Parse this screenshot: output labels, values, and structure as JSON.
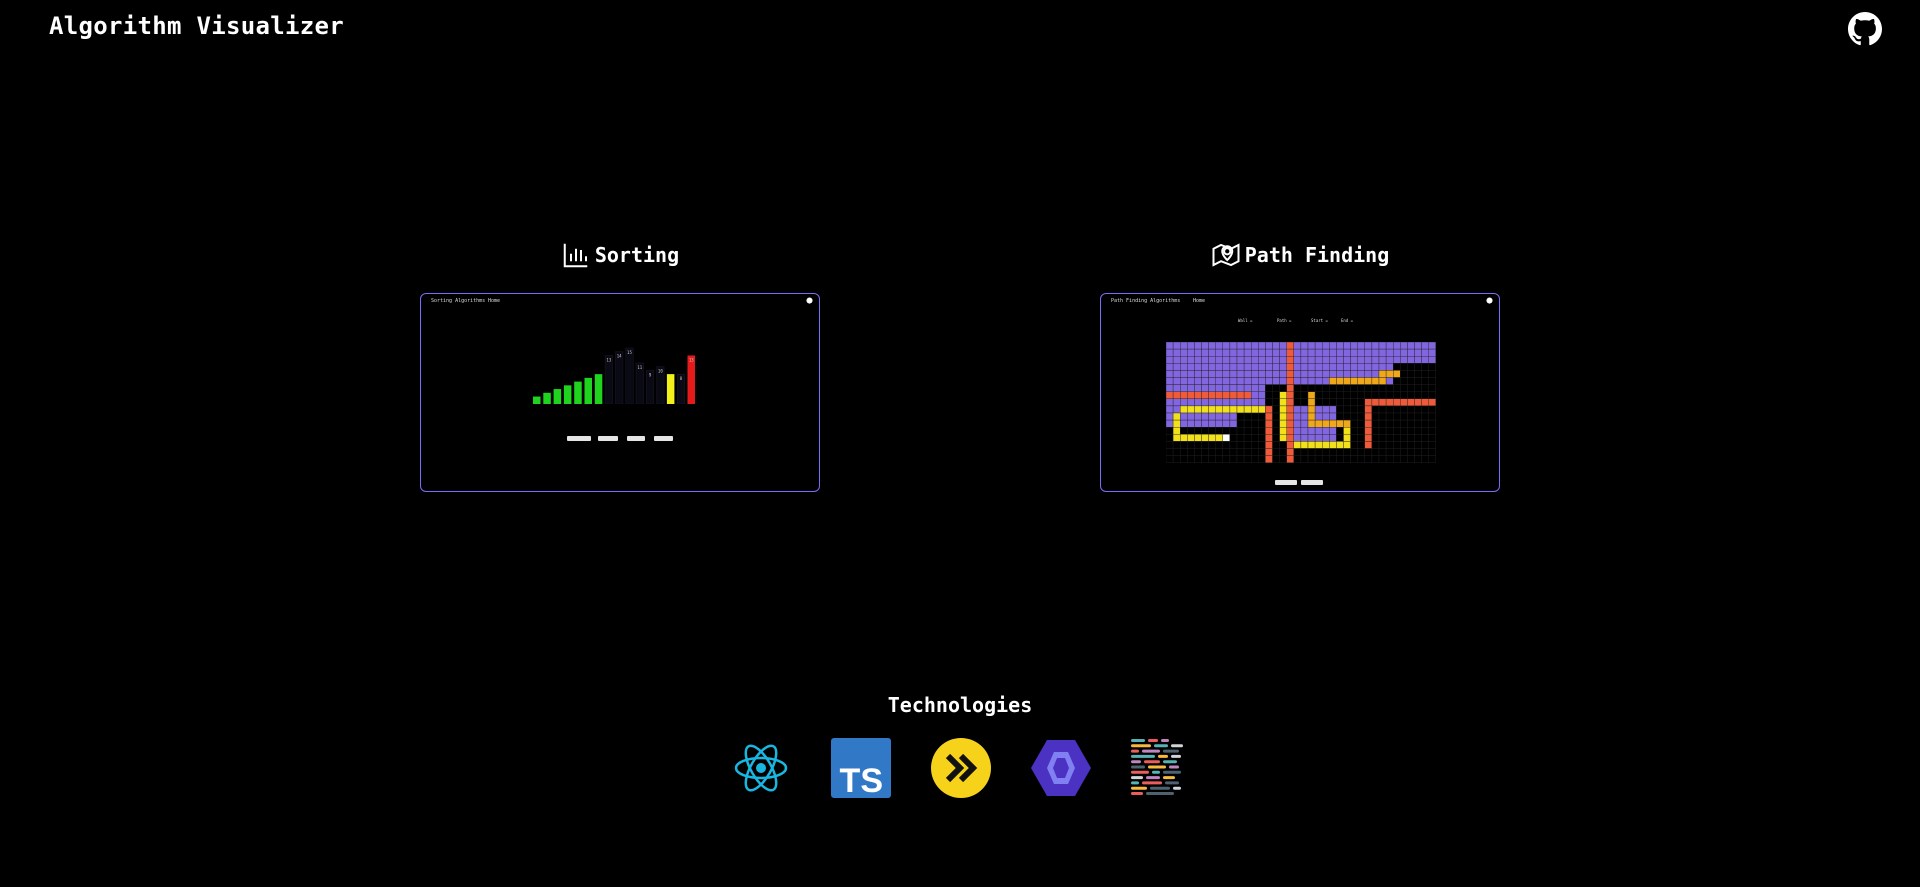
{
  "header": {
    "title": "Algorithm Visualizer",
    "github_icon": "github-icon"
  },
  "cards": [
    {
      "title": "Sorting",
      "icon": "bar-chart-icon",
      "preview": {
        "nav_title": "Sorting Algorithms",
        "nav_link": "Home",
        "bars": [
          {
            "value": 2,
            "color": "#1fd31f"
          },
          {
            "value": 3,
            "color": "#1fd31f"
          },
          {
            "value": 4,
            "color": "#1fd31f"
          },
          {
            "value": 5,
            "color": "#1fd31f"
          },
          {
            "value": 6,
            "color": "#1fd31f"
          },
          {
            "value": 7,
            "color": "#1fd31f"
          },
          {
            "value": 8,
            "color": "#1fd31f"
          },
          {
            "value": 13,
            "color": "#0a0a14",
            "label": "13"
          },
          {
            "value": 14,
            "color": "#0a0a14",
            "label": "14"
          },
          {
            "value": 15,
            "color": "#0a0a14",
            "label": "15"
          },
          {
            "value": 11,
            "color": "#0a0a14",
            "label": "11"
          },
          {
            "value": 9,
            "color": "#0a0a14",
            "label": "9"
          },
          {
            "value": 10,
            "color": "#0a0a14",
            "label": "10"
          },
          {
            "value": 8,
            "color": "#f2f21a"
          },
          {
            "value": 8,
            "color": "#0a0a14",
            "label": "8"
          },
          {
            "value": 13,
            "color": "#e51b1b",
            "label": "13"
          }
        ]
      }
    },
    {
      "title": "Path Finding",
      "icon": "map-pin-icon",
      "preview": {
        "nav_title": "Path Finding Algorithms",
        "nav_link": "Home",
        "legend": [
          "Wall =",
          "Path =",
          "Start =",
          "End ="
        ]
      }
    }
  ],
  "technologies": {
    "title": "Technologies",
    "items": [
      "react-icon",
      "typescript-icon",
      "vite-icon",
      "eslint-icon",
      "prettier-icon"
    ],
    "ts_label": "TS"
  }
}
